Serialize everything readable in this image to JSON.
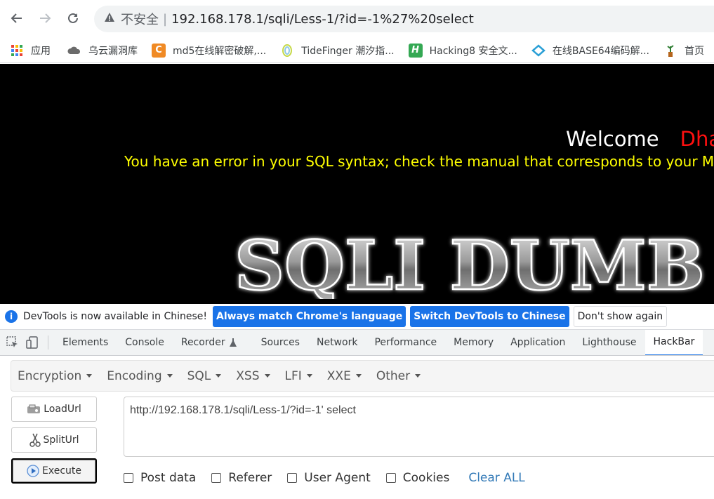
{
  "browser": {
    "security_label": "不安全",
    "url": "192.168.178.1/sqli/Less-1/?id=-1%27%20select"
  },
  "bookmarks": [
    {
      "label": "应用",
      "icon": "apps-grid-icon"
    },
    {
      "label": "乌云漏洞库",
      "icon": "cloud-icon"
    },
    {
      "label": "md5在线解密破解,...",
      "icon": "cmd5-icon"
    },
    {
      "label": "TideFinger 潮汐指...",
      "icon": "tidefinger-icon"
    },
    {
      "label": "Hacking8 安全文...",
      "icon": "hacking8-icon"
    },
    {
      "label": "在线BASE64编码解...",
      "icon": "base64-icon"
    },
    {
      "label": "首页",
      "icon": "plant-icon"
    }
  ],
  "page": {
    "welcome": "Welcome",
    "name": "Dhakkan",
    "sql_error": "You have an error in your SQL syntax; check the manual that corresponds to your MySQL server version for the right syntax",
    "logo_text": "SQLI DUMB"
  },
  "devtools": {
    "infobar": {
      "message": "DevTools is now available in Chinese!",
      "btn_match": "Always match Chrome's language",
      "btn_switch": "Switch DevTools to Chinese",
      "btn_dismiss": "Don't show again"
    },
    "tabs": [
      "Elements",
      "Console",
      "Recorder",
      "Sources",
      "Network",
      "Performance",
      "Memory",
      "Application",
      "Lighthouse",
      "HackBar"
    ],
    "active_tab": "HackBar"
  },
  "hackbar": {
    "menu": [
      "Encryption",
      "Encoding",
      "SQL",
      "XSS",
      "LFI",
      "XXE",
      "Other"
    ],
    "load_url": "LoadUrl",
    "split_url": "SplitUrl",
    "execute": "Execute",
    "url_value": "http://192.168.178.1/sqli/Less-1/?id=-1' select",
    "options": [
      "Post data",
      "Referer",
      "User Agent",
      "Cookies"
    ],
    "clear_all": "Clear ALL"
  },
  "colors": {
    "accent": "#1a73e8",
    "sql_error": "#ffff00",
    "name": "#ff1010",
    "link": "#337ab7"
  }
}
